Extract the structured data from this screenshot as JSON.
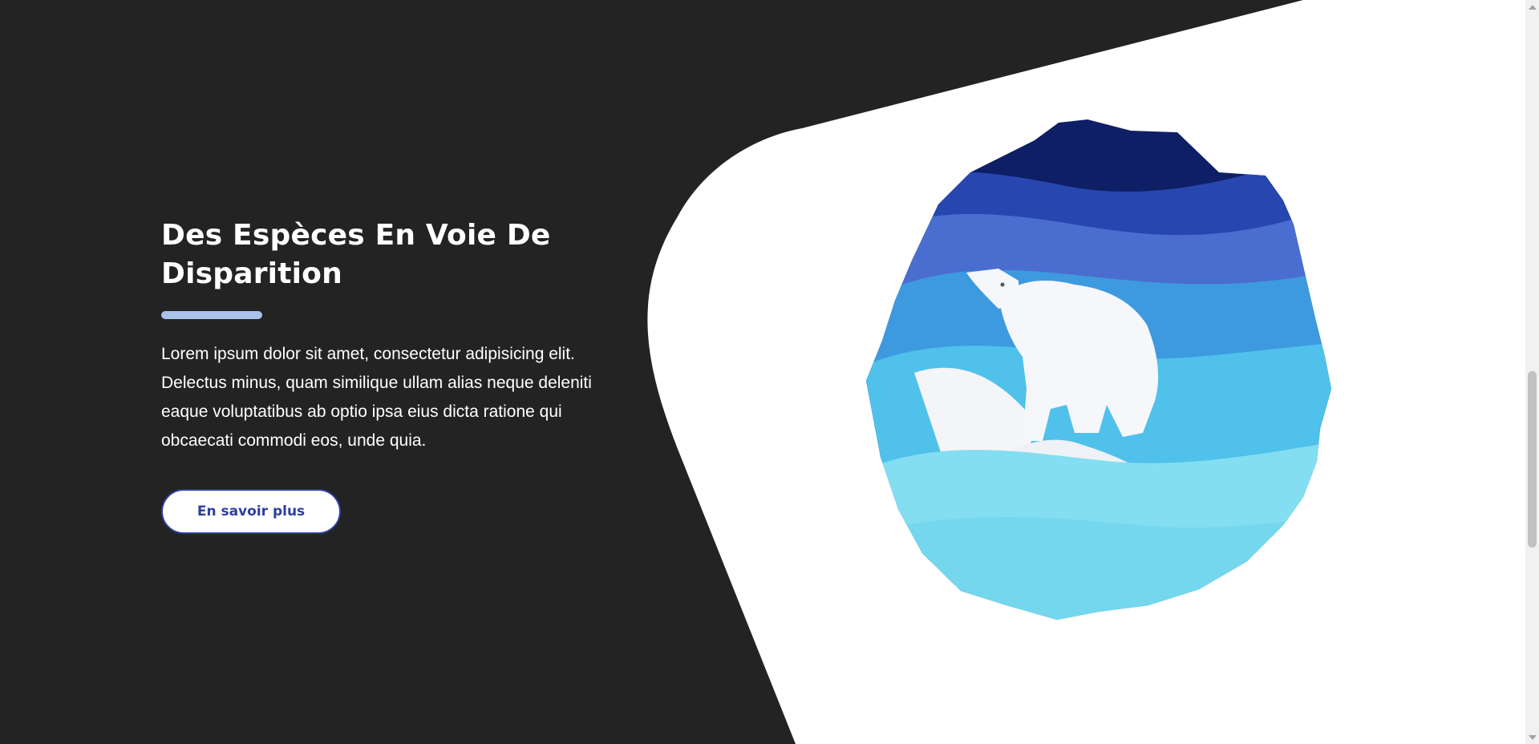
{
  "hero": {
    "title": "Des Espèces En Voie De Disparition",
    "description": "Lorem ipsum dolor sit amet, consectetur adipisicing elit. Delectus minus, quam similique ullam alias neque deleniti eaque voluptatibus ab optio ipsa eius dicta ratione qui obcaecati commodi eos, unde quia.",
    "cta_label": "En savoir plus",
    "illustration": "polar-bear-paper-art"
  },
  "colors": {
    "background": "#232323",
    "panel": "#ffffff",
    "accent_bar": "#a9c3ea",
    "button_border": "#2d3f9f"
  }
}
